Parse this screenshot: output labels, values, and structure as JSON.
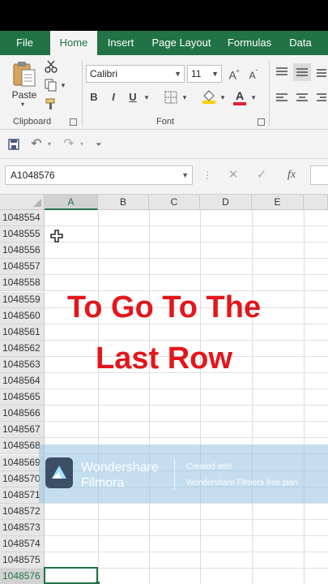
{
  "tabs": [
    "File",
    "Home",
    "Insert",
    "Page Layout",
    "Formulas",
    "Data"
  ],
  "active_tab": "Home",
  "ribbon": {
    "paste_label": "Paste",
    "clipboard_label": "Clipboard",
    "font_label": "Font",
    "font_name": "Calibri",
    "font_size": "11",
    "grow_font": "A",
    "shrink_font": "A",
    "bold": "B",
    "italic": "I",
    "underline": "U",
    "font_color_letter": "A",
    "accent_color": "#217346",
    "font_color": "#d9262b",
    "highlight_color": "#ffd000"
  },
  "formula_bar": {
    "name_box": "A1048576",
    "fx": "fx"
  },
  "columns": [
    "A",
    "B",
    "C",
    "D",
    "E"
  ],
  "rows": [
    "1048554",
    "1048555",
    "1048556",
    "1048557",
    "1048558",
    "1048559",
    "1048560",
    "1048561",
    "1048562",
    "1048563",
    "1048564",
    "1048565",
    "1048566",
    "1048567",
    "1048568",
    "1048569",
    "1048570",
    "1048571",
    "1048572",
    "1048573",
    "1048574",
    "1048575",
    "1048576"
  ],
  "selected_column": "A",
  "selected_row": "1048576",
  "overlay": {
    "line1": "To Go To The",
    "line2": "Last Row",
    "color": "#e3161b"
  },
  "watermark": {
    "brand_line1": "Wondershare",
    "brand_line2": "Filmora",
    "sub_line1": "Created with",
    "sub_line2": "Wondershare Filmora free plan"
  }
}
